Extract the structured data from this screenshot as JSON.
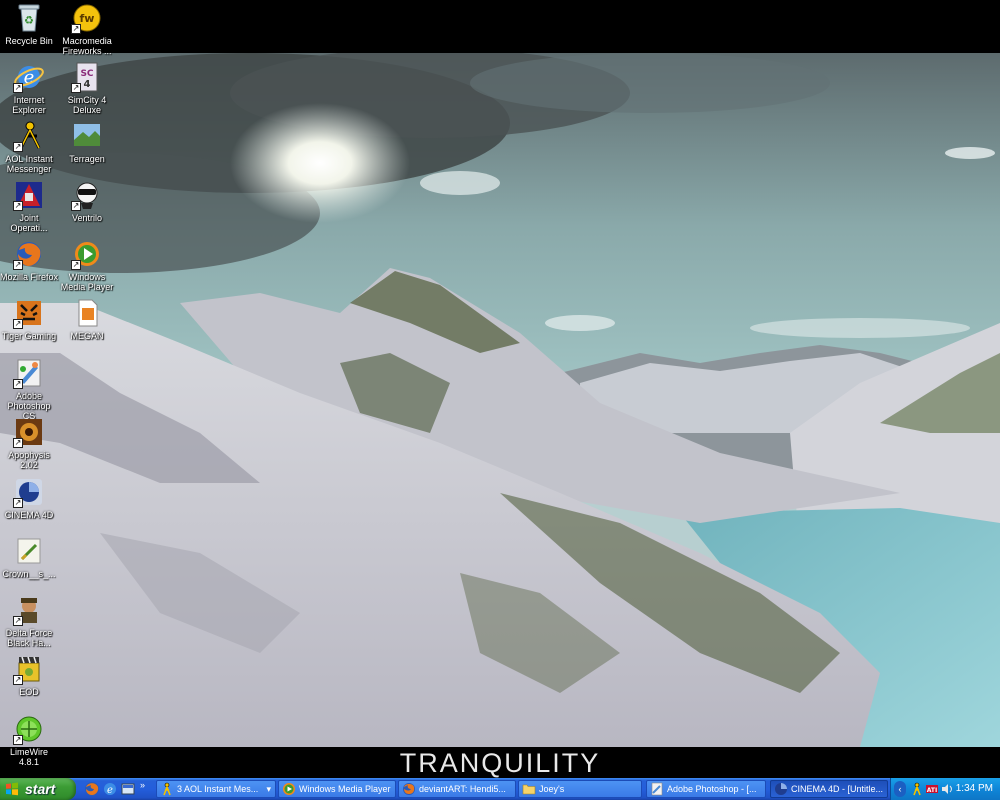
{
  "desktop": {
    "icons": [
      {
        "label": "Recycle Bin",
        "icon": "recycle-bin-icon"
      },
      {
        "label": "Macromedia Fireworks ...",
        "icon": "fireworks-icon"
      },
      {
        "label": "Internet Explorer",
        "icon": "internet-explorer-icon"
      },
      {
        "label": "SimCity 4 Deluxe",
        "icon": "simcity-icon"
      },
      {
        "label": "AOL Instant Messenger",
        "icon": "aim-icon"
      },
      {
        "label": "Terragen",
        "icon": "terragen-icon"
      },
      {
        "label": "Joint Operati...",
        "icon": "joint-operations-icon"
      },
      {
        "label": "Ventrilo",
        "icon": "ventrilo-icon"
      },
      {
        "label": "Mozilla Firefox",
        "icon": "firefox-icon"
      },
      {
        "label": "Windows Media Player",
        "icon": "media-player-icon"
      },
      {
        "label": "Tiger Gaming",
        "icon": "tiger-gaming-icon"
      },
      {
        "label": "MEGAN",
        "icon": "document-icon"
      },
      {
        "label": "Adobe Photoshop CS",
        "icon": "photoshop-icon"
      },
      {
        "label": "Apophysis 2.02",
        "icon": "apophysis-icon"
      },
      {
        "label": "CINEMA 4D",
        "icon": "cinema4d-icon"
      },
      {
        "label": "Crown__s_...",
        "icon": "image-file-icon"
      },
      {
        "label": "Delta Force Black Ha...",
        "icon": "delta-force-icon"
      },
      {
        "label": "EOD",
        "icon": "eod-icon"
      },
      {
        "label": "LimeWire 4.8.1",
        "icon": "limewire-icon"
      }
    ]
  },
  "wallpaper": {
    "caption": "TRANQUILITY",
    "sky_color": "#7fa8a8",
    "snow_color": "#cfd0d6",
    "water_color": "#7fc4cc"
  },
  "taskbar": {
    "start_label": "start",
    "buttons": [
      {
        "label": "3 AOL Instant Mes...",
        "icon": "aim-icon"
      },
      {
        "label": "Windows Media Player",
        "icon": "media-player-icon"
      },
      {
        "label": "deviantART: Hendi5...",
        "icon": "firefox-icon"
      },
      {
        "label": "Joey's",
        "icon": "folder-icon"
      },
      {
        "label": "Adobe Photoshop - [...",
        "icon": "photoshop-icon"
      },
      {
        "label": "CINEMA 4D - [Untitle...",
        "icon": "cinema4d-icon"
      }
    ],
    "clock": "1:34 PM",
    "colors": {
      "bar": "#245edb",
      "start": "#3c9c35",
      "tray": "#0f86d8"
    }
  }
}
